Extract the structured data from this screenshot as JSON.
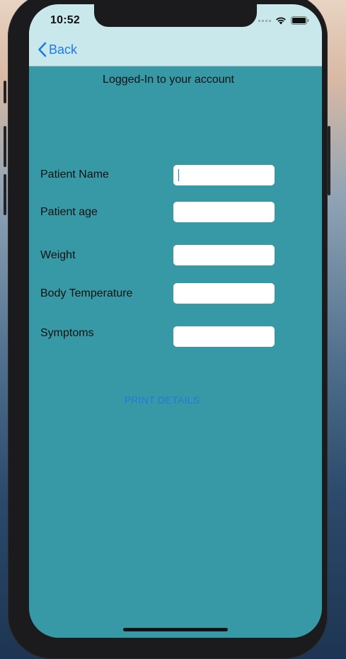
{
  "status_bar": {
    "time": "10:52"
  },
  "nav": {
    "back_label": "Back"
  },
  "header": {
    "title": "Logged-In to your account"
  },
  "form": {
    "fields": [
      {
        "label": "Patient Name",
        "value": ""
      },
      {
        "label": "Patient age",
        "value": ""
      },
      {
        "label": "Weight",
        "value": ""
      },
      {
        "label": "Body Temperature",
        "value": ""
      },
      {
        "label": "Symptoms",
        "value": ""
      }
    ],
    "print_label": "PRINT DETAILS"
  },
  "colors": {
    "screen_background": "#3799a5",
    "nav_background": "#c8e8ec",
    "accent": "#1f7ae0"
  },
  "icons": [
    "chevron-left-icon",
    "cellular-signal-icon",
    "wifi-icon",
    "battery-icon"
  ]
}
